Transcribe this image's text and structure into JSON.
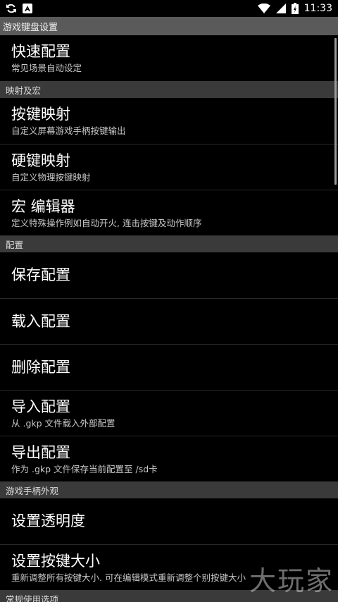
{
  "status": {
    "left_icons": [
      "sync-icon",
      "app-notification-icon"
    ],
    "right_icons": [
      "wifi-icon",
      "signal-icon",
      "battery-icon"
    ],
    "time": "11:33"
  },
  "title": "游戏键盘设置",
  "sections": [
    {
      "header": "",
      "items": [
        {
          "title": "快速配置",
          "subtitle": "常见场景自动设定"
        }
      ]
    },
    {
      "header": "映射及宏",
      "items": [
        {
          "title": "按键映射",
          "subtitle": "自定义屏幕游戏手柄按键输出"
        },
        {
          "title": "硬键映射",
          "subtitle": "自定义物理按键映射"
        },
        {
          "title": "宏 编辑器",
          "subtitle": "定义特殊操作例如自动开火, 连击按键及动作顺序"
        }
      ]
    },
    {
      "header": "配置",
      "items": [
        {
          "title": "保存配置",
          "subtitle": ""
        },
        {
          "title": "载入配置",
          "subtitle": ""
        },
        {
          "title": "删除配置",
          "subtitle": ""
        },
        {
          "title": "导入配置",
          "subtitle": "从 .gkp 文件载入外部配置"
        },
        {
          "title": "导出配置",
          "subtitle": "作为 .gkp 文件保存当前配置至 /sd卡"
        }
      ]
    },
    {
      "header": "游戏手柄外观",
      "items": [
        {
          "title": "设置透明度",
          "subtitle": ""
        },
        {
          "title": "设置按键大小",
          "subtitle": "重新调整所有按键大小. 可在编辑模式重新调整个别按键大小"
        }
      ]
    },
    {
      "header": "常规使用选项",
      "items": []
    }
  ],
  "watermark": "大玩家"
}
